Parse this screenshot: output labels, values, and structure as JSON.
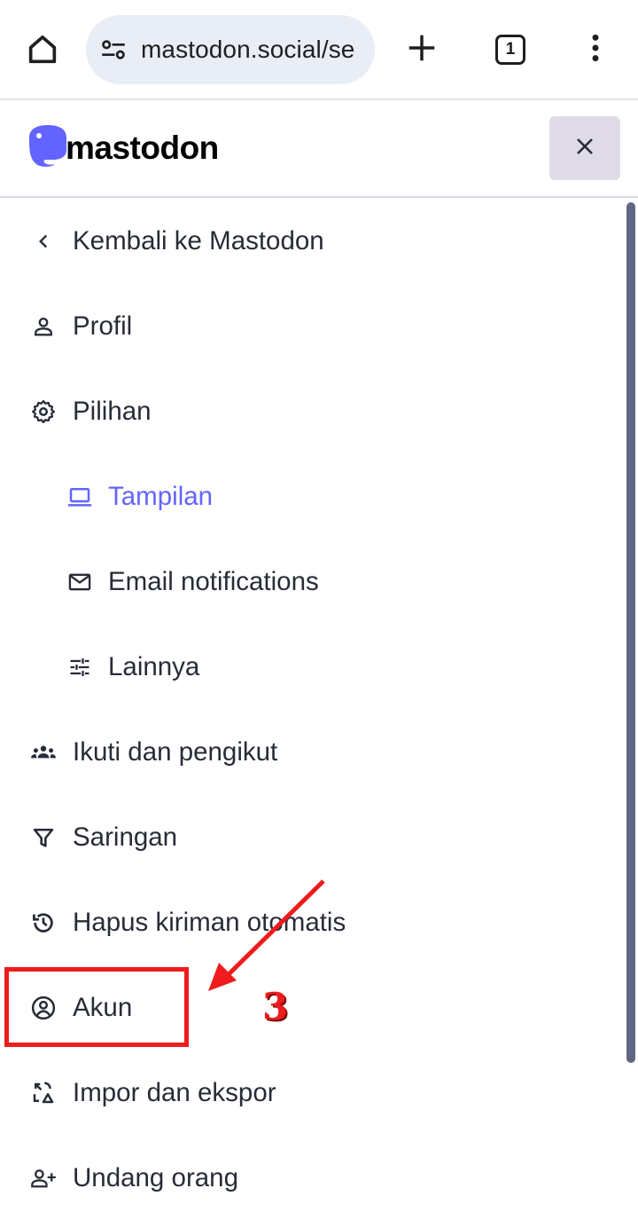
{
  "browser": {
    "url": "mastodon.social/se",
    "tab_count": "1",
    "icons": {
      "home": "home-icon",
      "site_settings": "tune-icon",
      "new_tab": "plus-icon",
      "tabs": "tab-switcher-icon",
      "menu": "more-vert-icon"
    }
  },
  "header": {
    "logo_text": "mastodon",
    "close_icon": "close-icon",
    "brand_color": "#6364ff"
  },
  "menu": {
    "items": [
      {
        "label": "Kembali ke Mastodon",
        "icon": "chevron-left-icon"
      },
      {
        "label": "Profil",
        "icon": "person-icon"
      },
      {
        "label": "Pilihan",
        "icon": "gear-icon"
      },
      {
        "label": "Tampilan",
        "icon": "laptop-icon",
        "active": true
      },
      {
        "label": "Email notifications",
        "icon": "mail-icon"
      },
      {
        "label": "Lainnya",
        "icon": "sliders-icon"
      },
      {
        "label": "Ikuti dan pengikut",
        "icon": "group-icon"
      },
      {
        "label": "Saringan",
        "icon": "filter-icon"
      },
      {
        "label": "Hapus kiriman otomatis",
        "icon": "history-icon"
      },
      {
        "label": "Akun",
        "icon": "account-circle-icon"
      },
      {
        "label": "Impor dan ekspor",
        "icon": "import-export-icon"
      },
      {
        "label": "Undang orang",
        "icon": "person-add-icon"
      }
    ]
  },
  "annotation": {
    "step_number": "3",
    "color": "#ee1c1c"
  }
}
